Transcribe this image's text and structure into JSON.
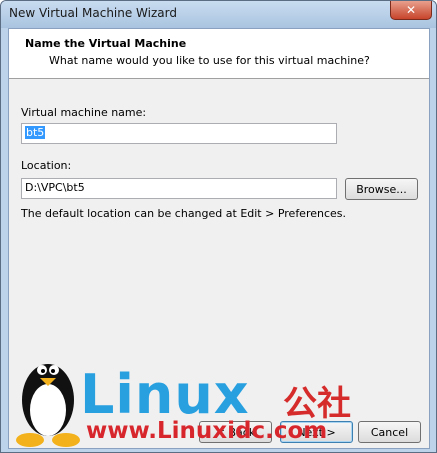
{
  "window": {
    "title": "New Virtual Machine Wizard"
  },
  "header": {
    "title": "Name the Virtual Machine",
    "subtitle": "What name would you like to use for this virtual machine?"
  },
  "form": {
    "vm_name_label": "Virtual machine name:",
    "vm_name_value": "bt5",
    "location_label": "Location:",
    "location_value": "D:\\VPC\\bt5",
    "browse_label": "Browse...",
    "note": "The default location can be changed at Edit > Preferences."
  },
  "buttons": {
    "back": "< Back",
    "next": "Next >",
    "cancel": "Cancel"
  },
  "watermark": {
    "brand": "Linux",
    "brand_cn": "公社",
    "url": "www.Linuxidc.com"
  },
  "colors": {
    "selection": "#3399ff",
    "watermark_blue": "#28a0e0",
    "watermark_red": "#d8262d"
  }
}
